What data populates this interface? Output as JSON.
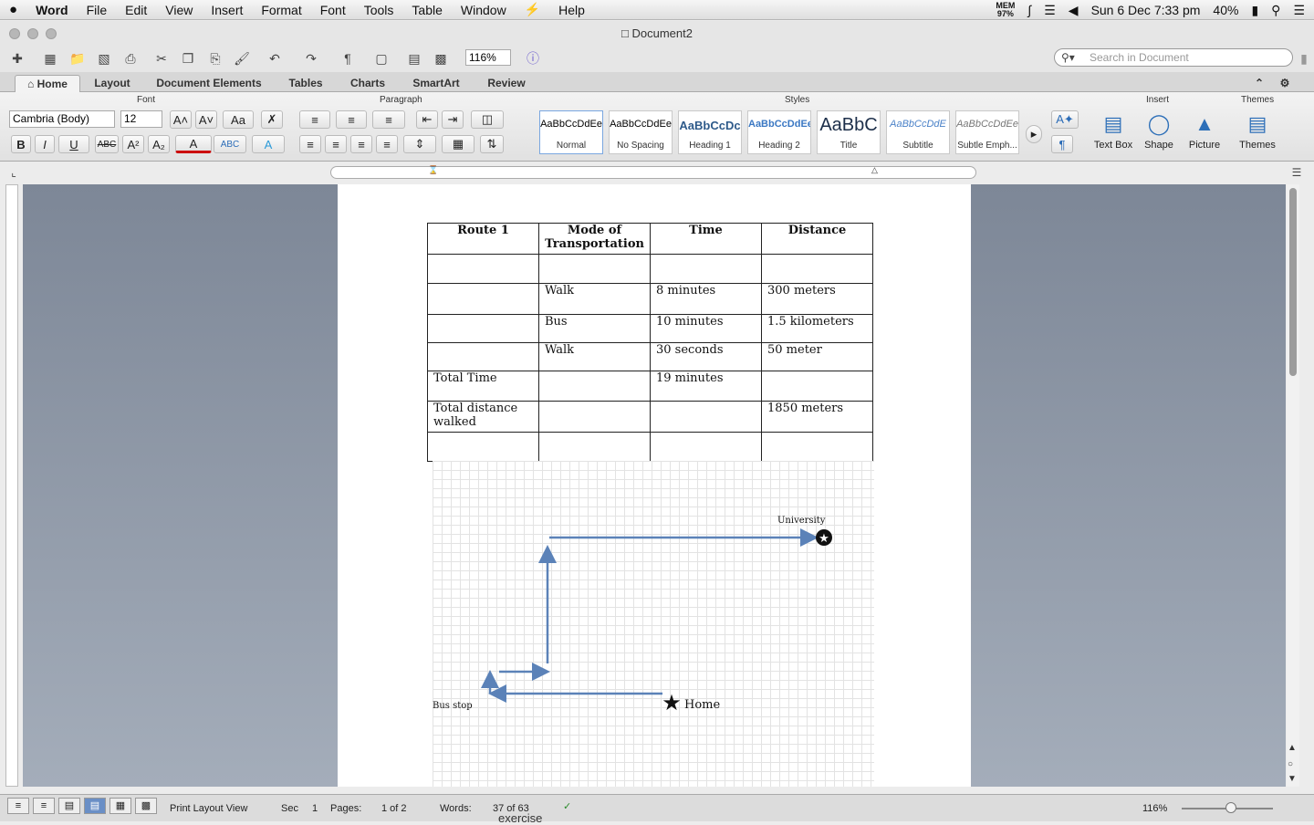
{
  "menubar": {
    "items": [
      "Word",
      "File",
      "Edit",
      "View",
      "Insert",
      "Format",
      "Font",
      "Tools",
      "Table",
      "Window",
      "Help"
    ],
    "mem_label": "MEM",
    "mem_value": "97%",
    "datetime": "Sun 6 Dec 7:33 pm",
    "battery": "40%"
  },
  "window": {
    "title": "Document2"
  },
  "toolbar": {
    "zoom": "116%",
    "search_placeholder": "Search in Document"
  },
  "ribbon_tabs": [
    "Home",
    "Layout",
    "Document Elements",
    "Tables",
    "Charts",
    "SmartArt",
    "Review"
  ],
  "ribbon": {
    "group_font": "Font",
    "group_paragraph": "Paragraph",
    "group_styles": "Styles",
    "group_insert": "Insert",
    "group_themes": "Themes",
    "font_name": "Cambria (Body)",
    "font_size": "12",
    "styles": [
      {
        "preview": "AaBbCcDdEe",
        "name": "Normal"
      },
      {
        "preview": "AaBbCcDdEe",
        "name": "No Spacing"
      },
      {
        "preview": "AaBbCcDc",
        "name": "Heading 1"
      },
      {
        "preview": "AaBbCcDdEe",
        "name": "Heading 2"
      },
      {
        "preview": "AaBbC",
        "name": "Title"
      },
      {
        "preview": "AaBbCcDdE",
        "name": "Subtitle"
      },
      {
        "preview": "AaBbCcDdEe",
        "name": "Subtle Emph..."
      }
    ],
    "insert": [
      {
        "name": "Text Box"
      },
      {
        "name": "Shape"
      },
      {
        "name": "Picture"
      },
      {
        "name": "Themes"
      }
    ]
  },
  "document": {
    "table": {
      "headers": [
        "Route 1",
        "Mode of Transportation",
        "Time",
        "Distance"
      ],
      "rows": [
        [
          "",
          "",
          "",
          ""
        ],
        [
          "",
          "Walk",
          "8 minutes",
          "300 meters"
        ],
        [
          "",
          "Bus",
          "10 minutes",
          "1.5 kilometers"
        ],
        [
          "",
          "Walk",
          "30 seconds",
          "50 meter"
        ],
        [
          "Total Time",
          "",
          "19 minutes",
          ""
        ],
        [
          "Total distance walked",
          "",
          "",
          "1850 meters"
        ],
        [
          "",
          "",
          "",
          ""
        ]
      ]
    },
    "diagram": {
      "university_label": "University",
      "home_label": "Home",
      "bus_stop_label": "Bus stop"
    }
  },
  "statusbar": {
    "view": "Print Layout View",
    "sec_label": "Sec",
    "sec_value": "1",
    "pages_label": "Pages:",
    "pages_value": "1 of 2",
    "words_label": "Words:",
    "words_value": "37 of 63",
    "zoom": "116%",
    "overflow_text": "exercise"
  },
  "colors": {
    "arrow": "#5b82b8",
    "workspace": "#8e98a8"
  }
}
